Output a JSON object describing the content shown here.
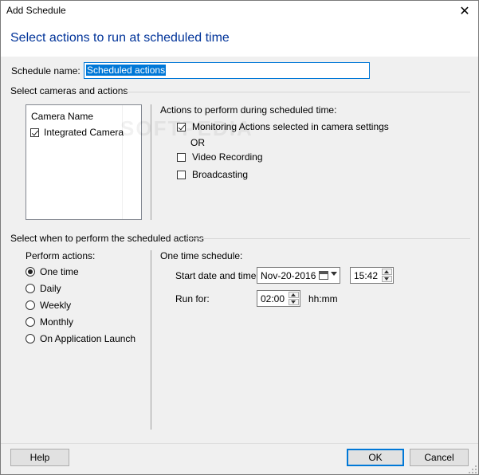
{
  "window": {
    "title": "Add Schedule",
    "close_glyph": "✕"
  },
  "heading": "Select actions to run at scheduled time",
  "schedule_name": {
    "label": "Schedule name:",
    "value": "Scheduled actions"
  },
  "cameras_section": {
    "title": "Select cameras and actions",
    "list_header": "Camera Name",
    "cameras": [
      {
        "label": "Integrated Camera",
        "checked": true
      }
    ],
    "actions_title": "Actions to perform during scheduled time:",
    "actions": [
      {
        "label": "Monitoring Actions selected in camera settings",
        "checked": true
      },
      {
        "label": "Video Recording",
        "checked": false
      },
      {
        "label": "Broadcasting",
        "checked": false
      }
    ],
    "or_text": "OR"
  },
  "watermark": "SOFTPEDIA",
  "when_section": {
    "title": "Select when to perform the scheduled actions",
    "perform_title": "Perform actions:",
    "options": [
      {
        "label": "One time",
        "checked": true
      },
      {
        "label": "Daily",
        "checked": false
      },
      {
        "label": "Weekly",
        "checked": false
      },
      {
        "label": "Monthly",
        "checked": false
      },
      {
        "label": "On Application Launch",
        "checked": false
      }
    ],
    "schedule_title": "One time schedule:",
    "start_label": "Start date and time:",
    "start_date": "Nov-20-2016",
    "start_time": "15:42",
    "run_for_label": "Run for:",
    "run_for_value": "02:00",
    "run_for_unit": "hh:mm"
  },
  "footer": {
    "help": "Help",
    "ok": "OK",
    "cancel": "Cancel"
  }
}
